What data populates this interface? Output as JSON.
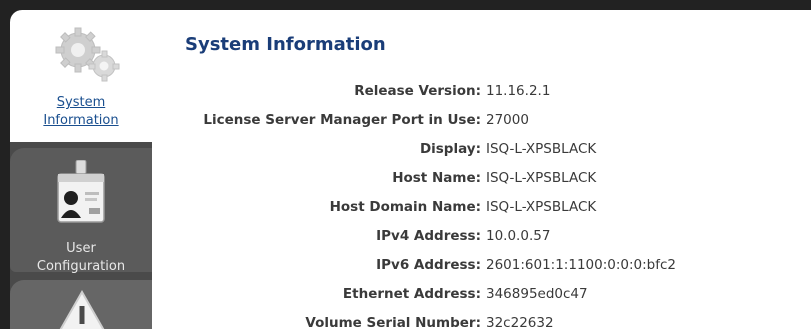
{
  "sidebar": {
    "tabs": [
      {
        "label_line1": "System",
        "label_line2": "Information",
        "icon": "gears-icon"
      },
      {
        "label_line1": "User",
        "label_line2": "Configuration",
        "icon": "id-badge-icon"
      },
      {
        "icon": "warning-icon"
      }
    ]
  },
  "main": {
    "title": "System Information",
    "rows": [
      {
        "label": "Release Version:",
        "value": "11.16.2.1"
      },
      {
        "label": "License Server Manager Port in Use:",
        "value": "27000"
      },
      {
        "label": "Display:",
        "value": "ISQ-L-XPSBLACK"
      },
      {
        "label": "Host Name:",
        "value": "ISQ-L-XPSBLACK"
      },
      {
        "label": "Host Domain Name:",
        "value": "ISQ-L-XPSBLACK"
      },
      {
        "label": "IPv4 Address:",
        "value": "10.0.0.57"
      },
      {
        "label": "IPv6 Address:",
        "value": "2601:601:1:1100:0:0:0:bfc2"
      },
      {
        "label": "Ethernet Address:",
        "value": "346895ed0c47"
      },
      {
        "label": "Volume Serial Number:",
        "value": "32c22632"
      }
    ]
  }
}
